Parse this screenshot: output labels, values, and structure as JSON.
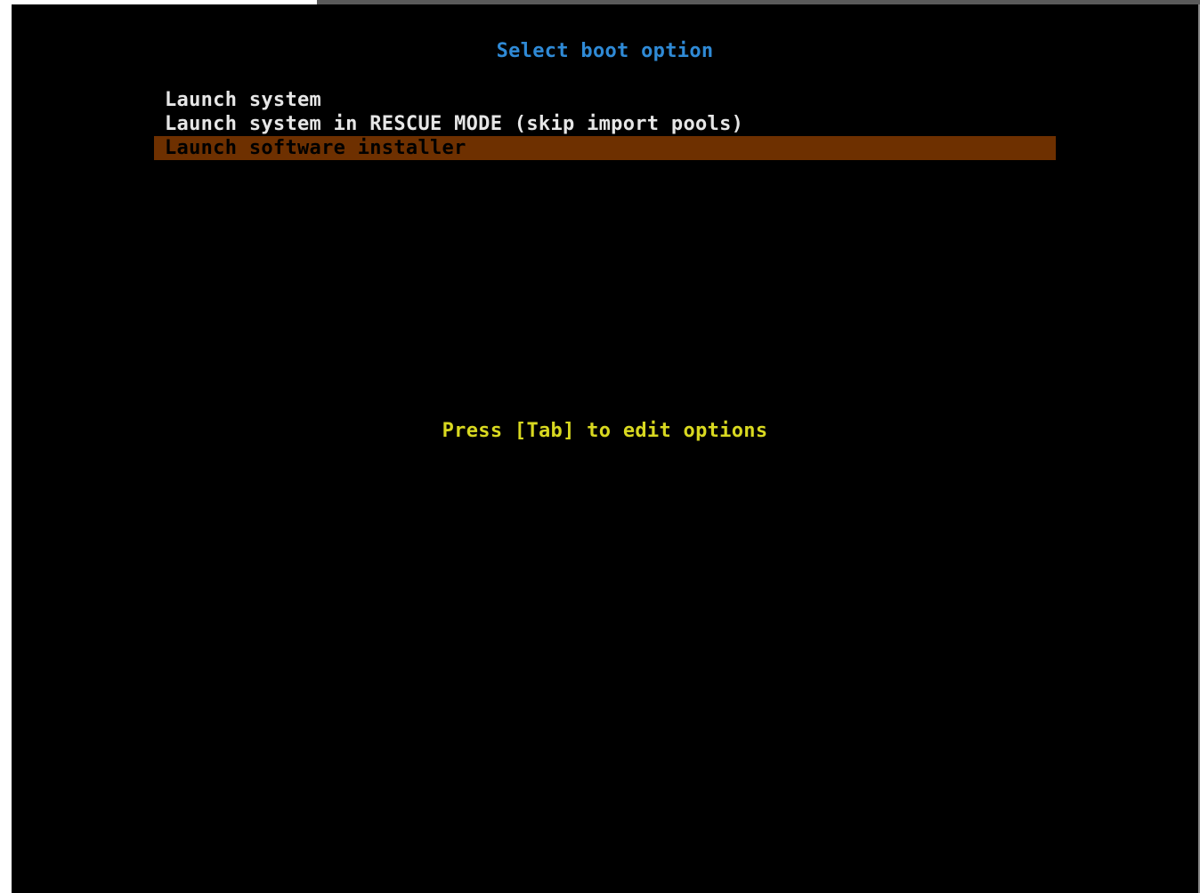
{
  "boot_menu": {
    "title": "Select boot option",
    "items": [
      {
        "label": "Launch system",
        "selected": false
      },
      {
        "label": "Launch system in RESCUE MODE (skip import pools)",
        "selected": false
      },
      {
        "label": "Launch software installer",
        "selected": true
      }
    ],
    "hint": "Press [Tab] to edit options"
  },
  "colors": {
    "background": "#000000",
    "title": "#2f8ad6",
    "item_text": "#e6e6e6",
    "selected_bg": "#6e3000",
    "selected_text": "#000000",
    "hint": "#d8d820"
  }
}
